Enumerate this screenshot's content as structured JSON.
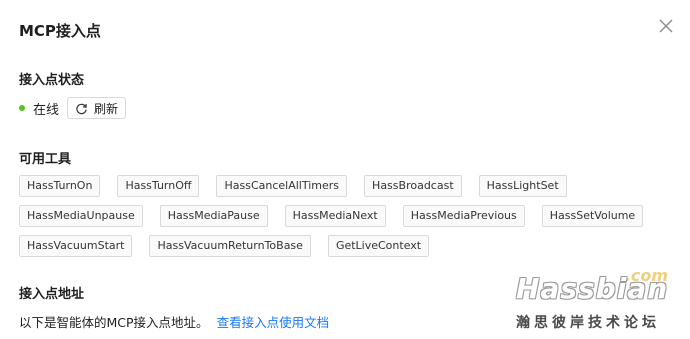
{
  "dialog": {
    "title": "MCP接入点",
    "close_icon": "close-icon"
  },
  "status_section": {
    "heading": "接入点状态",
    "status_text": "在线",
    "status_color": "#52c41a",
    "refresh_icon": "refresh-icon",
    "refresh_label": "刷新"
  },
  "tools_section": {
    "heading": "可用工具",
    "rows": [
      [
        "HassTurnOn",
        "HassTurnOff",
        "HassCancelAllTimers",
        "HassBroadcast",
        "HassLightSet"
      ],
      [
        "HassMediaUnpause",
        "HassMediaPause",
        "HassMediaNext",
        "HassMediaPrevious",
        "HassSetVolume"
      ],
      [
        "HassVacuumStart",
        "HassVacuumReturnToBase",
        "GetLiveContext"
      ]
    ]
  },
  "endpoint_section": {
    "heading": "接入点地址",
    "description": "以下是智能体的MCP接入点地址。",
    "doc_link": "查看接入点使用文档",
    "link_color": "#1677ff"
  },
  "watermark": {
    "suffix": ".com",
    "brand": "Hassbian",
    "subtitle": "瀚思彼岸技术论坛"
  }
}
